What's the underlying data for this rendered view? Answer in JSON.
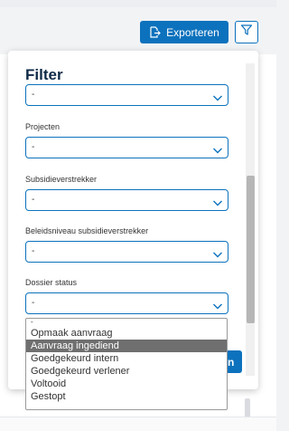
{
  "toolbar": {
    "export_label": "Exporteren"
  },
  "filter": {
    "title": "Filter",
    "fields": [
      {
        "label": "",
        "value": "-"
      },
      {
        "label": "Projecten",
        "value": "-"
      },
      {
        "label": "Subsidieverstrekker",
        "value": "-"
      },
      {
        "label": "Beleidsniveau subsidieverstrekker",
        "value": "-"
      },
      {
        "label": "Dossier status",
        "value": "-"
      }
    ],
    "apply_label": "n"
  },
  "dossier_status_options": [
    "-",
    "Opmaak aanvraag",
    "Aanvraag ingediend",
    "Goedgekeurd intern",
    "Goedgekeurd verlener",
    "Voltooid",
    "Gestopt"
  ],
  "selected_option": "Aanvraag ingediend",
  "colors": {
    "accent": "#0d72bd",
    "title": "#0e2a47",
    "highlight": "#6f6f6f"
  },
  "icons": {
    "export": "export-icon",
    "filter": "filter-icon",
    "chevron": "chevron-down-icon"
  }
}
